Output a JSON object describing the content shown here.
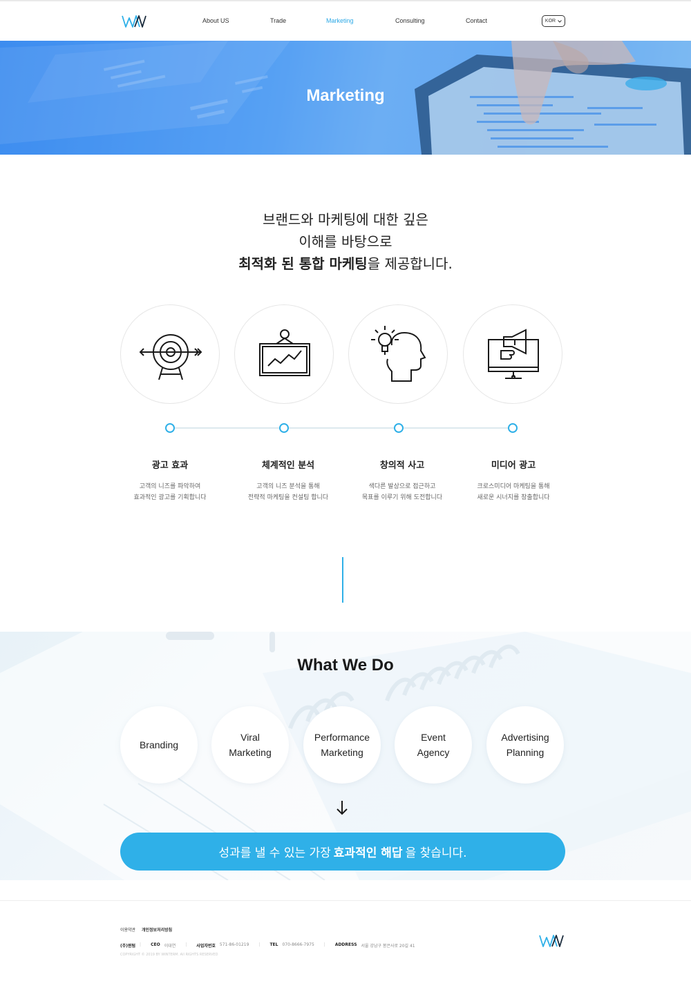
{
  "brand": {
    "logo": "wm-logo",
    "accent": "#2fb0e8",
    "nav_active": "#2ba8e6"
  },
  "nav": {
    "items": [
      "About US",
      "Trade",
      "Marketing",
      "Consulting",
      "Contact"
    ],
    "active": "Marketing",
    "lang": "KOR"
  },
  "hero": {
    "title": "Marketing"
  },
  "intro": {
    "line1": "브랜드와 마케팅에 대한 깊은",
    "line2": "이해를 바탕으로",
    "line3_bold": "최적화 된 통합 마케팅",
    "line3_rest": "을 제공합니다."
  },
  "features": [
    {
      "icon": "target-icon",
      "title": "광고 효과",
      "desc1": "고객의 니즈를 파악하여",
      "desc2": "효과적인 광고를 기획합니다"
    },
    {
      "icon": "chart-board-icon",
      "title": "체계적인 분석",
      "desc1": "고객의 니즈 분석을 통해",
      "desc2": "전략적 마케팅을 컨설팅 합니다"
    },
    {
      "icon": "idea-head-icon",
      "title": "창의적 사고",
      "desc1": "색다른 발상으로 접근하고",
      "desc2": "목표를 이루기 위해 도전합니다"
    },
    {
      "icon": "media-monitor-icon",
      "title": "미디어 광고",
      "desc1": "크로스미디어 마케팅을 통해",
      "desc2": "새로운 시너지를 창출합니다"
    }
  ],
  "what_we_do": {
    "title": "What We Do",
    "services": [
      {
        "l1": "Branding",
        "l2": ""
      },
      {
        "l1": "Viral",
        "l2": "Marketing"
      },
      {
        "l1": "Performance",
        "l2": "Marketing"
      },
      {
        "l1": "Event",
        "l2": "Agency"
      },
      {
        "l1": "Advertising",
        "l2": "Planning"
      }
    ],
    "cta_pre": "성과를 낼 수 있는 가장",
    "cta_bold": "효과적인 해답",
    "cta_post": "을 찾습니다."
  },
  "footer": {
    "links": [
      "이용약관",
      "개인정보처리방침"
    ],
    "company": "(주)윈텀",
    "ceo_label": "CEO",
    "ceo": "이대연",
    "biz_label": "사업자번호",
    "biz": "571-86-01219",
    "tel_label": "TEL",
    "tel": "070-8666-7975",
    "addr_label": "ADDRESS",
    "addr": "서울 강남구 봉은사로 20길 41",
    "copyright": "COPYRIGHT © 2019 BY WINTERM. All RIGHTS RESERVED"
  }
}
